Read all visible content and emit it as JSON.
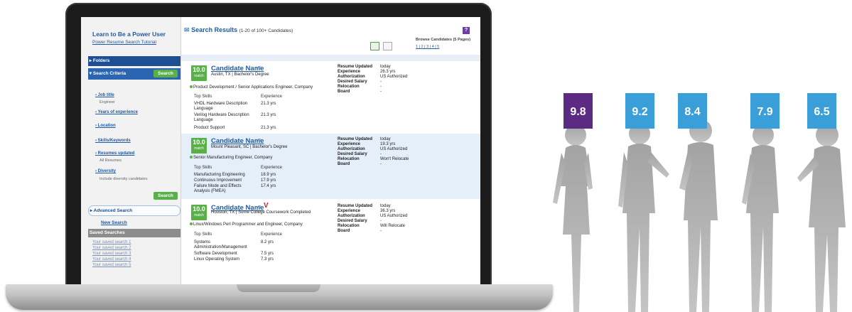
{
  "sidebar": {
    "title": "Learn to Be a Power User",
    "tutorial_link": "Power Resume Search Tutorial",
    "folders": "Folders",
    "search_criteria": "Search Criteria",
    "search_button": "Search",
    "criteria": [
      {
        "label": "Job title",
        "sub": "Engineer"
      },
      {
        "label": "Years of experience",
        "sub": ""
      },
      {
        "label": "Location",
        "sub": ""
      },
      {
        "label": "Skills/Keywords",
        "sub": ""
      },
      {
        "label": "Resumes updated",
        "sub": "All Resumes"
      },
      {
        "label": "Diversity",
        "sub": "Include diversity candidates"
      }
    ],
    "search_button_bottom": "Search",
    "advanced_search": "Advanced Search",
    "new_search": "New Search",
    "saved_searches_header": "Saved Searches",
    "saved_searches": [
      "Your saved search 1",
      "Your saved search 2",
      "Your saved search 3",
      "Your saved search 4",
      "Your saved search 5"
    ]
  },
  "results": {
    "title": "Search Results",
    "count": "(1-20 of 100+ Candidates)",
    "help": "?",
    "browse_label": "Browse Candidates (5 Pages)",
    "pages": "1 | 2 | 3 | 4 | 5"
  },
  "candidates": [
    {
      "score": "10.0",
      "match": "match",
      "name": "Candidate Name",
      "location": "Austin, TX | Bachelor's Degree",
      "job": "Product Development / Senior Applications Engineer, Company",
      "skills_header": "Top Skills",
      "exp_header": "Experience",
      "skills": [
        {
          "name": "VHDL Hardware Description Language",
          "yrs": "21.3 yrs"
        },
        {
          "name": "Verilog Hardware Description Language",
          "yrs": "21.3 yrs"
        },
        {
          "name": "Product Support",
          "yrs": "21.3 yrs"
        }
      ],
      "meta": [
        {
          "k": "Resume Updated",
          "v": "today"
        },
        {
          "k": "Experience",
          "v": "26.3 yrs"
        },
        {
          "k": "Authorization",
          "v": "US Authorized"
        },
        {
          "k": "Desired Salary",
          "v": "-"
        },
        {
          "k": "Relocation",
          "v": "-"
        },
        {
          "k": "Board",
          "v": "-"
        }
      ]
    },
    {
      "score": "10.0",
      "match": "match",
      "name": "Candidate Name",
      "location": "Mount Pleasant, SC | Bachelor's Degree",
      "job": "Senior Manufacturing Engineer, Company",
      "skills_header": "Top Skills",
      "exp_header": "Experience",
      "skills": [
        {
          "name": "Manufacturing Engineering",
          "yrs": "18.9 yrs"
        },
        {
          "name": "Continuous Improvement",
          "yrs": "17.9 yrs"
        },
        {
          "name": "Failure Mode and Effects Analysis (FMEA)",
          "yrs": "17.4 yrs"
        }
      ],
      "meta": [
        {
          "k": "Resume Updated",
          "v": "today"
        },
        {
          "k": "Experience",
          "v": "19.3 yrs"
        },
        {
          "k": "Authorization",
          "v": "US Authorized"
        },
        {
          "k": "Desired Salary",
          "v": "-"
        },
        {
          "k": "Relocation",
          "v": "Won't Relocate"
        },
        {
          "k": "Board",
          "v": "-"
        }
      ]
    },
    {
      "score": "10.0",
      "match": "match",
      "name": "Candidate Name",
      "location": "Houston, TX | Some College Coursework Completed",
      "job": "Linux/Windows Perl Programmer and Engineer, Company",
      "skills_header": "Top Skills",
      "exp_header": "Experience",
      "skills": [
        {
          "name": "Systems Administration/Management",
          "yrs": "8.2 yrs"
        },
        {
          "name": "Software Development",
          "yrs": "7.5 yrs"
        },
        {
          "name": "Linux Operating System",
          "yrs": "7.3 yrs"
        }
      ],
      "meta": [
        {
          "k": "Resume Updated",
          "v": "today"
        },
        {
          "k": "Experience",
          "v": "36.3 yrs"
        },
        {
          "k": "Authorization",
          "v": "US Authorized"
        },
        {
          "k": "Desired Salary",
          "v": "-"
        },
        {
          "k": "Relocation",
          "v": "Will Relocate"
        },
        {
          "k": "Board",
          "v": "-"
        }
      ]
    }
  ],
  "people_scores": [
    "9.8",
    "9.2",
    "8.4",
    "7.9",
    "6.5"
  ],
  "colors": {
    "score_purple": "#5b2a83",
    "score_blue": "#3a9fd8",
    "match_green": "#5ab048",
    "link_blue": "#1f5aa3",
    "silhouette": "#aaaaaa"
  }
}
